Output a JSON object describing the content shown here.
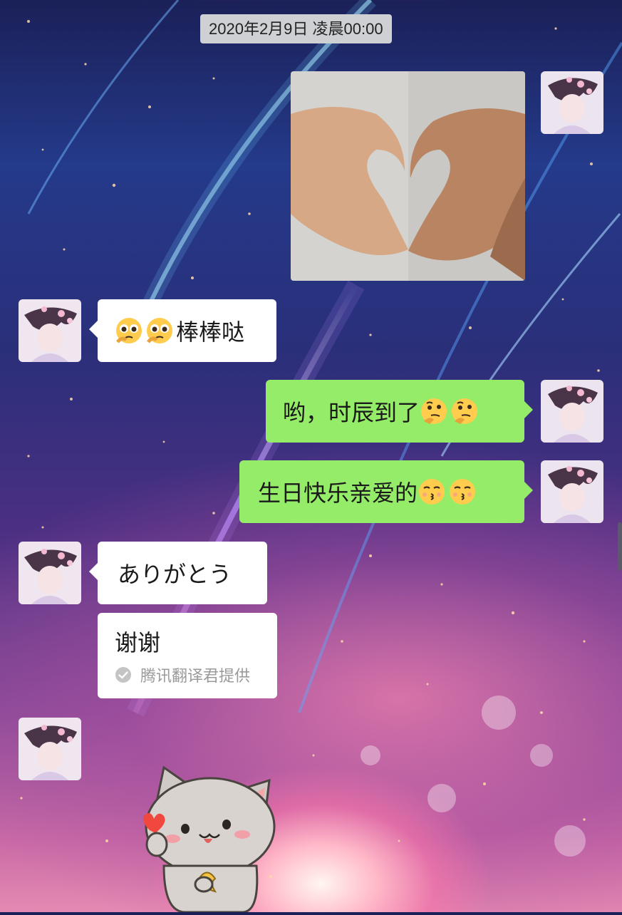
{
  "chat": {
    "timestamp": "2020年2月9日 凌晨00:00",
    "messages": [
      {
        "side": "right",
        "type": "image",
        "alt": "hands-heart-photo"
      },
      {
        "side": "left",
        "type": "text",
        "emoji": [
          "pleading-face",
          "pleading-face"
        ],
        "text": "棒棒哒"
      },
      {
        "side": "right",
        "type": "text",
        "text": "哟，时辰到了",
        "emoji_after": [
          "thinking-face",
          "thinking-face"
        ]
      },
      {
        "side": "right",
        "type": "text",
        "text": "生日快乐亲爱的",
        "emoji_after": [
          "kissing-face",
          "kissing-face"
        ]
      },
      {
        "side": "left",
        "type": "text",
        "text": "ありがとう"
      },
      {
        "side": "left",
        "type": "translation",
        "text": "谢谢",
        "provider": "腾讯翻译君提供"
      },
      {
        "side": "left",
        "type": "sticker",
        "alt": "cat-sticker-holding-heart"
      }
    ]
  },
  "colors": {
    "incoming_bubble": "#ffffff",
    "outgoing_bubble": "#95ec69",
    "timestamp_bg": "#cfd0d3"
  }
}
